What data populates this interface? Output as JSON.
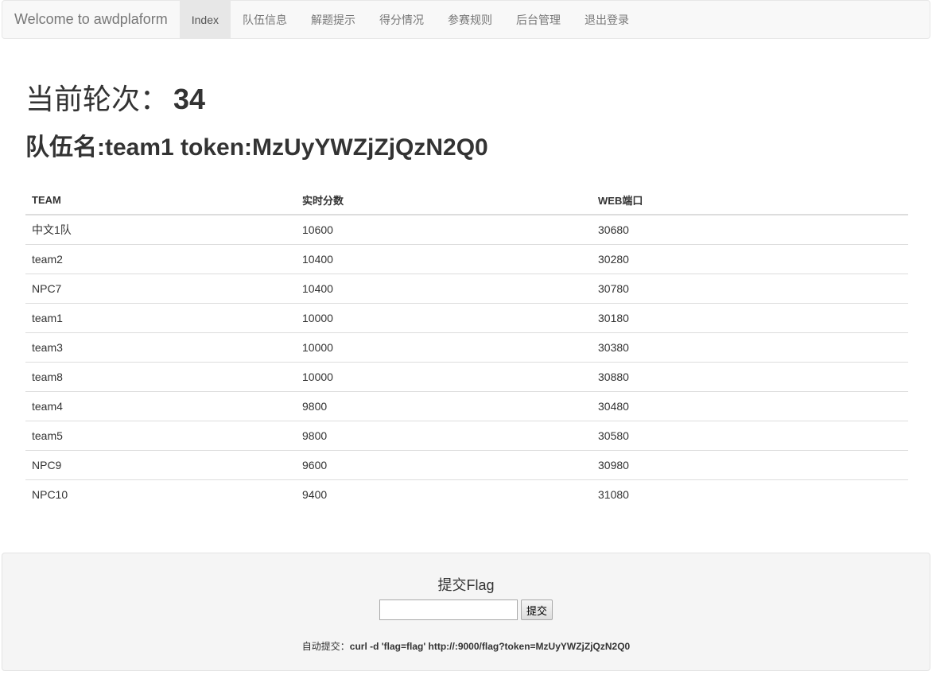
{
  "nav": {
    "brand": "Welcome to awdplaform",
    "items": [
      {
        "label": "Index",
        "active": true
      },
      {
        "label": "队伍信息",
        "active": false
      },
      {
        "label": "解题提示",
        "active": false
      },
      {
        "label": "得分情况",
        "active": false
      },
      {
        "label": "参赛规则",
        "active": false
      },
      {
        "label": "后台管理",
        "active": false
      },
      {
        "label": "退出登录",
        "active": false
      }
    ]
  },
  "round": {
    "label": "当前轮次：",
    "value": "34"
  },
  "team": {
    "heading": "队伍名:team1 token:MzUyYWZjZjQzN2Q0"
  },
  "table": {
    "headers": [
      "TEAM",
      "实时分数",
      "WEB端口"
    ],
    "rows": [
      [
        "中文1队",
        "10600",
        "30680"
      ],
      [
        "team2",
        "10400",
        "30280"
      ],
      [
        "NPC7",
        "10400",
        "30780"
      ],
      [
        "team1",
        "10000",
        "30180"
      ],
      [
        "team3",
        "10000",
        "30380"
      ],
      [
        "team8",
        "10000",
        "30880"
      ],
      [
        "team4",
        "9800",
        "30480"
      ],
      [
        "team5",
        "9800",
        "30580"
      ],
      [
        "NPC9",
        "9600",
        "30980"
      ],
      [
        "NPC10",
        "9400",
        "31080"
      ]
    ]
  },
  "flag": {
    "title": "提交Flag",
    "input_value": "",
    "submit_label": "提交",
    "auto_label": "自动提交：",
    "auto_command": "curl -d 'flag=flag' http://:9000/flag?token=MzUyYWZjZjQzN2Q0"
  }
}
